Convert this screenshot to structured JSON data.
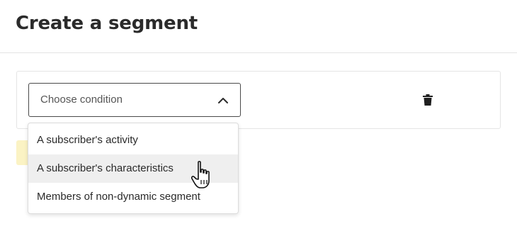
{
  "header": {
    "title": "Create a segment"
  },
  "condition": {
    "select_placeholder": "Choose condition",
    "dropdown_open": true,
    "options": [
      {
        "label": "A subscriber's activity",
        "hovered": false
      },
      {
        "label": "A subscriber's characteristics",
        "hovered": true
      },
      {
        "label": "Members of non-dynamic segment",
        "hovered": false
      }
    ]
  },
  "icons": {
    "chevron": "chevron-up-icon",
    "delete": "trash-icon",
    "cursor": "hand-pointer-icon"
  },
  "colors": {
    "border_dark": "#4a4a4a",
    "hover_bg": "#efefef",
    "highlight_chip": "#fbf3c4"
  }
}
